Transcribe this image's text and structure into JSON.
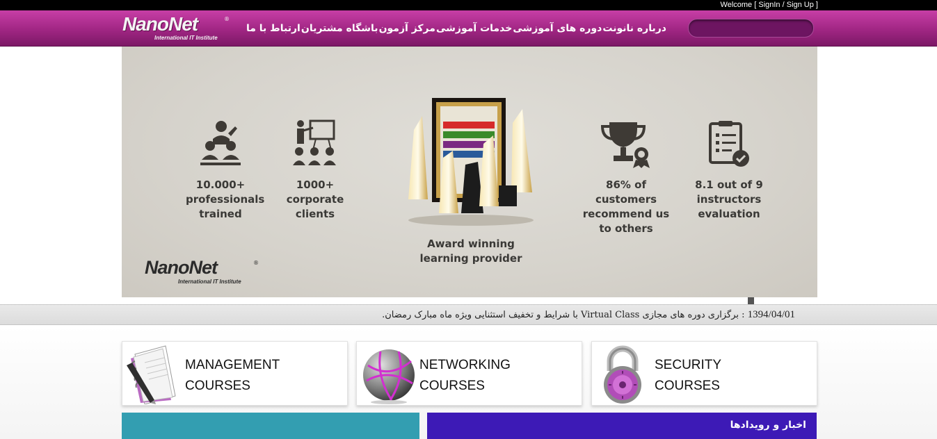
{
  "auth": {
    "welcome": "Welcome [",
    "signin": "SignIn",
    "sep": " / ",
    "signup": "Sign Up",
    "end": " ]"
  },
  "header": {
    "logo_text": "NanoNet",
    "logo_sub": "International IT Institute",
    "logo_reg": "®",
    "nav": [
      "درباره نانونت",
      "دوره های آموزشی",
      "خدمات آموزشی",
      "مرکز آزمون",
      "باشگاه مشتریان",
      "ارتباط با ما"
    ],
    "colors": {
      "bar": "#a02683",
      "search": "#6d1561"
    }
  },
  "hero": {
    "stats": [
      {
        "line1": "10.000+",
        "line2": "professionals",
        "line3": "trained",
        "icon": "audience-icon"
      },
      {
        "line1": "1000+",
        "line2": "corporate",
        "line3": "clients",
        "icon": "presentation-icon"
      },
      {
        "line1": "Award winning",
        "line2": "learning provider",
        "line3": "",
        "icon": "awards-icon"
      },
      {
        "line1": "86% of customers",
        "line2": "recommend us",
        "line3": "to others",
        "icon": "trophy-icon"
      },
      {
        "line1": "8.1 out of 9",
        "line2": "instructors",
        "line3": "evaluation",
        "icon": "clipboard-check-icon"
      }
    ],
    "logo_text": "NanoNet",
    "logo_sub": "International IT Institute",
    "logo_reg": "®"
  },
  "ticker": {
    "date": "1394/04/01",
    "text": " : برگزاری دوره های مجازی Virtual Class با شرایط و تخفیف استثنایی ویژه ماه مبارک رمضان."
  },
  "courses": [
    {
      "line1": "MANAGEMENT",
      "line2": "COURSES",
      "icon": "notebook-pen-icon"
    },
    {
      "line1": "NETWORKING",
      "line2": "COURSES",
      "icon": "globe-network-icon"
    },
    {
      "line1": "SECURITY",
      "line2": "COURSES",
      "icon": "padlock-icon"
    }
  ],
  "news": {
    "title": "اخبار و رویدادها"
  }
}
